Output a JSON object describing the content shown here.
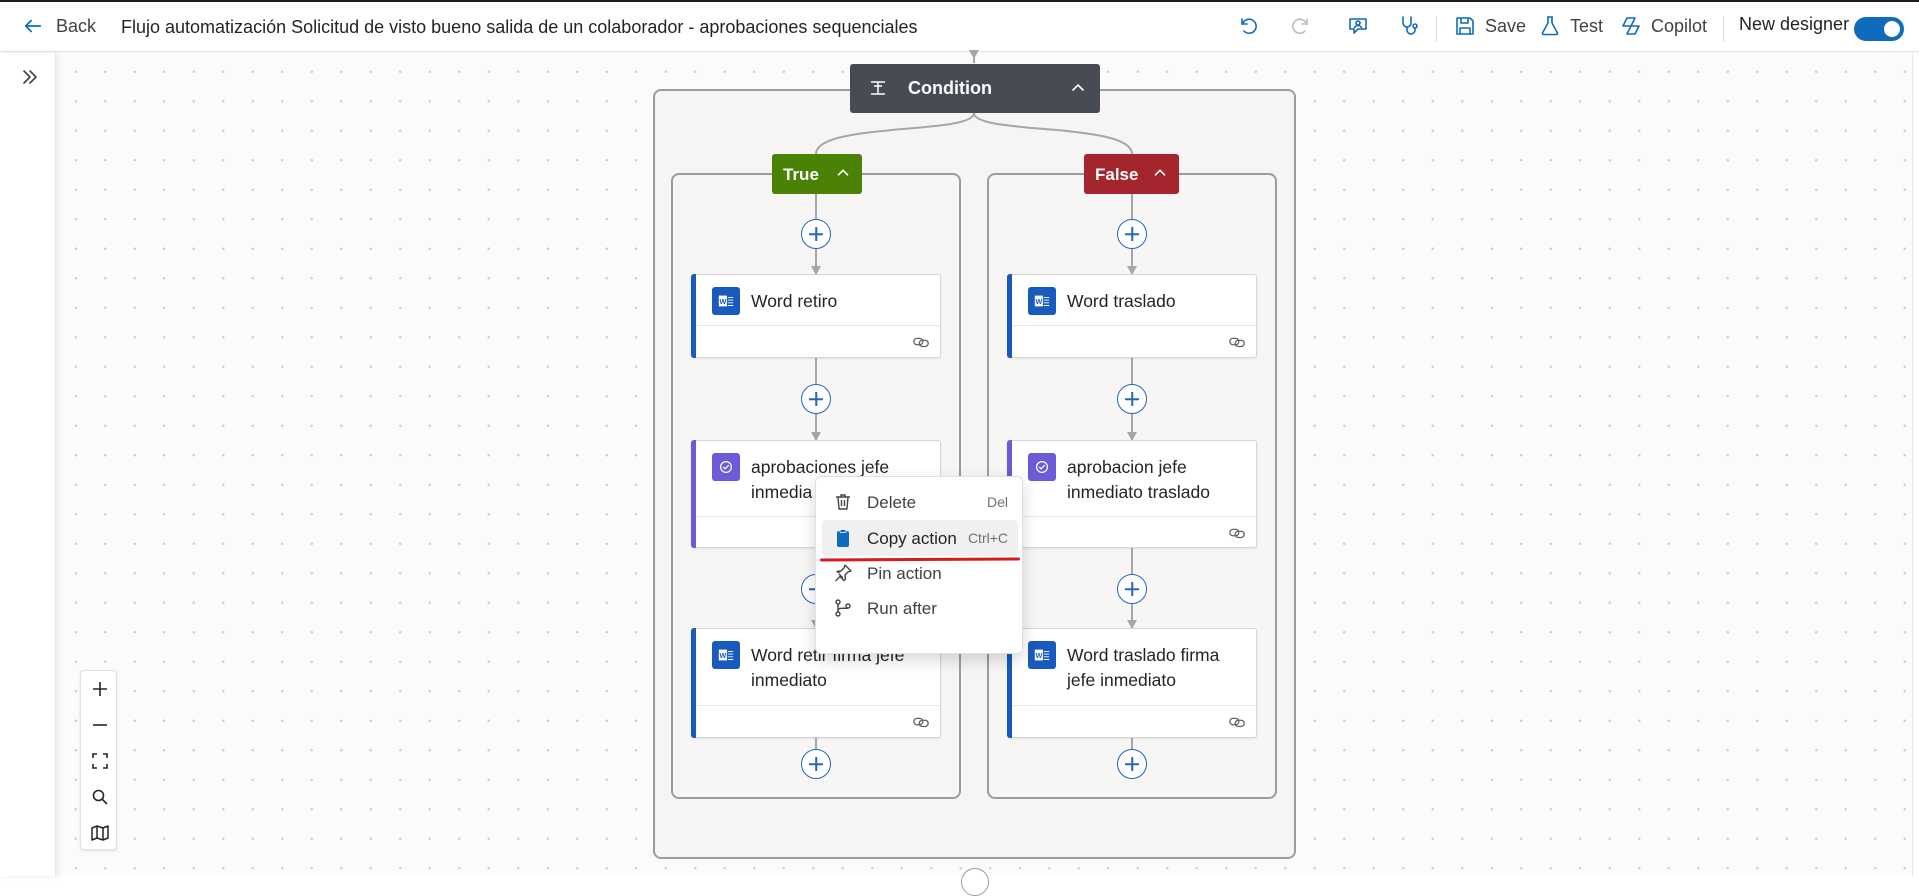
{
  "header": {
    "back_label": "Back",
    "title": "Flujo automatización Solicitud de visto bueno salida de un colaborador - aprobaciones sequenciales",
    "save_label": "Save",
    "test_label": "Test",
    "copilot_label": "Copilot",
    "new_designer_label": "New designer",
    "new_designer_enabled": true
  },
  "condition": {
    "label": "Condition",
    "true_label": "True",
    "false_label": "False",
    "true_color": "#498205",
    "false_color": "#a4262c"
  },
  "true_branch": [
    {
      "title": "Word retiro",
      "icon": "word-icon"
    },
    {
      "title": "aprobaciones jefe inmediato",
      "visible_title": "aprobaciones jefe inmedia",
      "icon": "approvals-icon"
    },
    {
      "title": "Word retir firma jefe inmediato",
      "icon": "word-icon"
    }
  ],
  "false_branch": [
    {
      "title": "Word traslado",
      "icon": "word-icon"
    },
    {
      "title": "aprobacion jefe inmediato traslado",
      "icon": "approvals-icon"
    },
    {
      "title": "Word traslado firma jefe inmediato",
      "icon": "word-icon"
    }
  ],
  "context_menu": {
    "items": [
      {
        "label": "Delete",
        "shortcut": "Del",
        "icon": "trash-icon"
      },
      {
        "label": "Copy action",
        "shortcut": "Ctrl+C",
        "icon": "clipboard-icon",
        "highlighted": true
      },
      {
        "label": "Pin action",
        "shortcut": "",
        "icon": "pin-icon"
      },
      {
        "label": "Run after",
        "shortcut": "",
        "icon": "branch-icon"
      }
    ]
  },
  "zoom_controls": [
    "zoom-in",
    "zoom-out",
    "fit-view",
    "search",
    "minimap"
  ],
  "colors": {
    "accent": "#0f6cbd",
    "word": "#185abd",
    "approvals": "#6b5bd6",
    "highlight_underline": "#d61b1b"
  }
}
